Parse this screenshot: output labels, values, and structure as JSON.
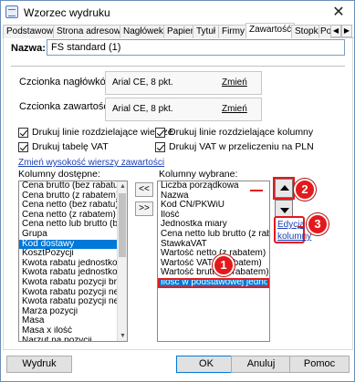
{
  "window": {
    "title": "Wzorzec wydruku",
    "close": "✕"
  },
  "tabs": [
    "Podstawowe",
    "Strona adresowa",
    "Nagłówek",
    "Papier",
    "Tytuł",
    "Firmy",
    "Zawartość",
    "Stopka",
    "Pomoc"
  ],
  "tab_active": "Zawartość",
  "tab_scroll": {
    "left": "◀",
    "right": "▶"
  },
  "name": {
    "label": "Nazwa:",
    "value": "FS standard (1)"
  },
  "fonts": {
    "headers_label": "Czcionka nagłówków:",
    "headers_value": "Arial CE, 8 pkt.",
    "contents_label": "Czcionka zawartości:",
    "contents_value": "Arial CE, 8 pkt.",
    "change": "Zmień"
  },
  "checks": {
    "row_lines": "Drukuj linie rozdzielające wiersze",
    "col_lines": "Drukuj linie rozdzielające kolumny",
    "vat_table": "Drukuj tabelę VAT",
    "vat_pln": "Drukuj VAT w przeliczeniu na PLN"
  },
  "row_height_link": "Zmień wysokość wierszy zawartości",
  "available": {
    "label": "Kolumny dostępne:",
    "items": [
      "Cena brutto (bez rabatu)",
      "Cena brutto (z rabatem)",
      "Cena netto (bez rabatu)",
      "Cena netto (z rabatem)",
      "Cena netto lub brutto (bez rabatu)",
      "Grupa",
      "Kod dostawy",
      "KosztPozycji",
      "Kwota rabatu jednostkowego",
      "Kwota rabatu jednostkowego",
      "Kwota rabatu pozycji brutto",
      "Kwota rabatu pozycji netto",
      "Kwota rabatu pozycji netto lub",
      "Marża pozycji",
      "Masa",
      "Masa x ilość",
      "Narzut na pozycji"
    ],
    "selected_index": 6
  },
  "move": {
    "add": "<<",
    "remove": ">>"
  },
  "chosen": {
    "label": "Kolumny wybrane:",
    "items": [
      "Liczba porządkowa",
      "Nazwa",
      "Kod CN/PKWiU",
      "Ilość",
      "Jednostka miary",
      "Cena netto lub brutto (z rabatem)",
      "StawkaVAT",
      "Wartość netto (z rabatem)",
      "Wartość VAT (z rabatem)",
      "Wartość brutto (z rabatem)",
      "Ilość w podstawowej jednostce miary"
    ],
    "selected_index": 10
  },
  "edit": {
    "line1": "Edycja",
    "line2": "kolumny"
  },
  "callouts": [
    "1",
    "2",
    "3"
  ],
  "footer": {
    "print": "Wydruk",
    "ok": "OK",
    "cancel": "Anuluj",
    "help": "Pomoc"
  },
  "colors": {
    "accent": "#0078d7",
    "callout": "#e3191c",
    "link": "#1a3fb5"
  }
}
